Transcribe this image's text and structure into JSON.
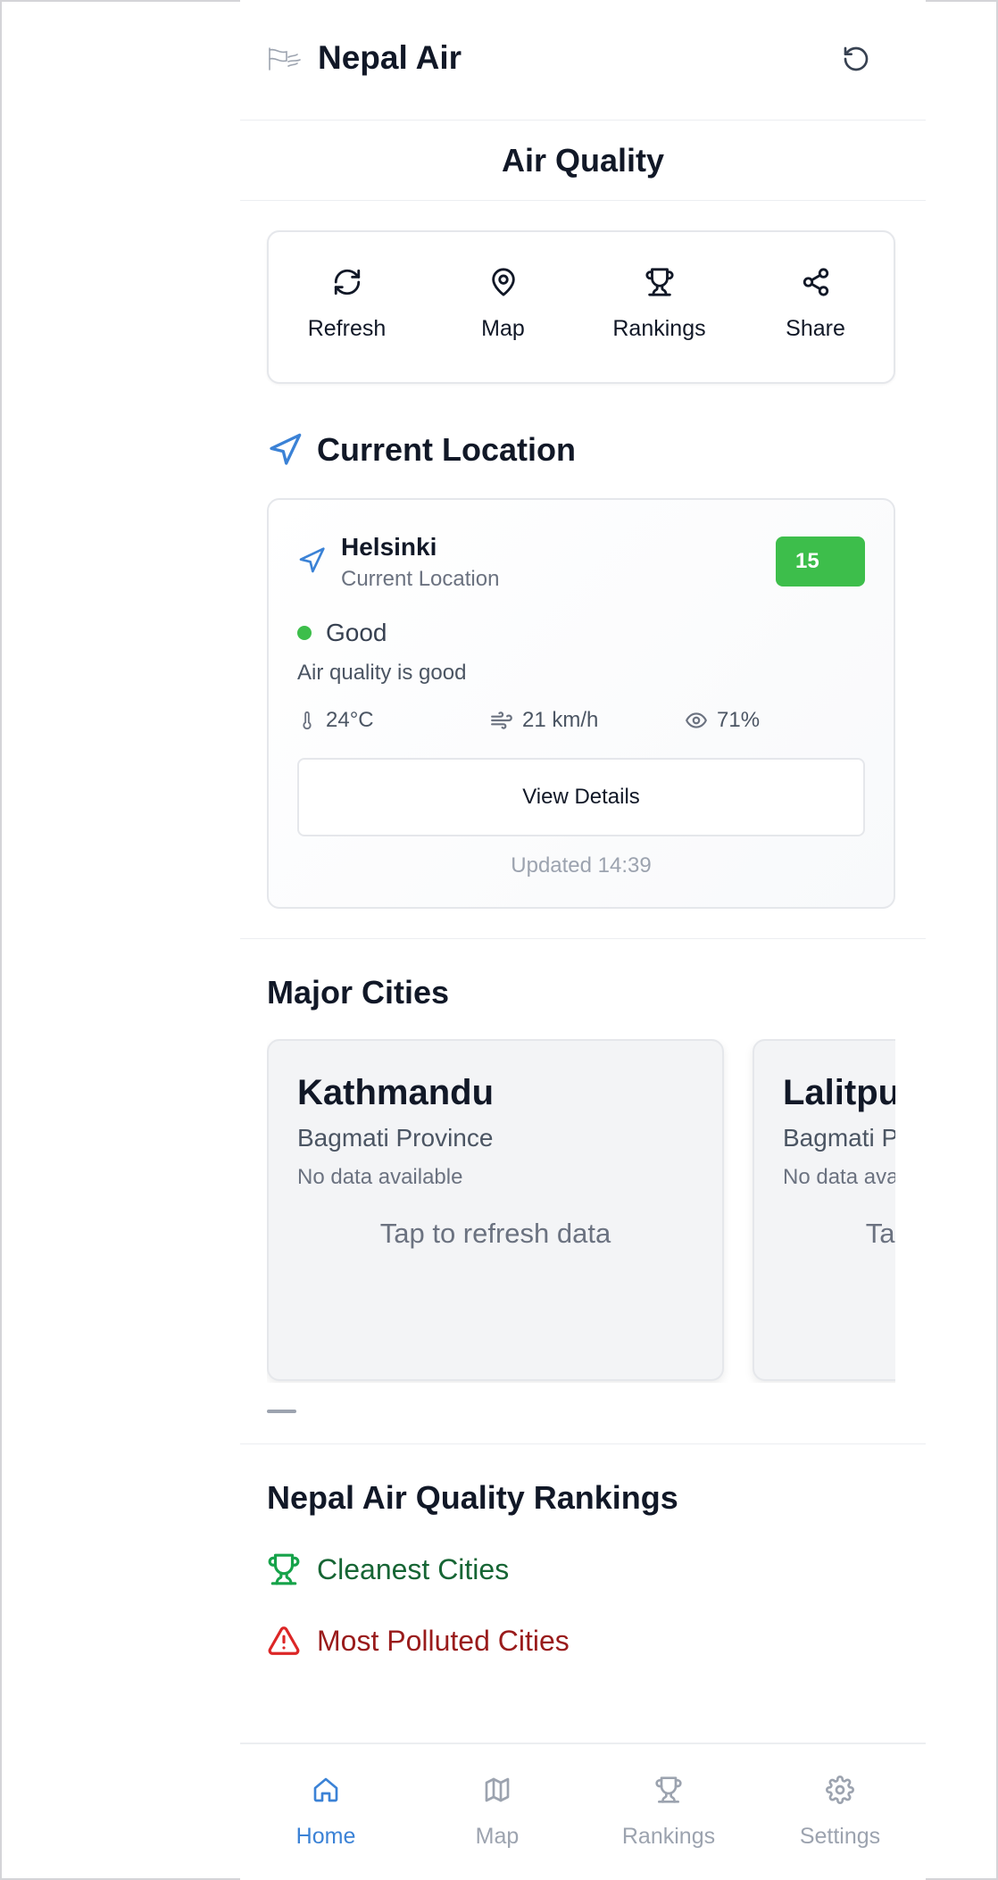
{
  "header": {
    "app_title": "Nepal Air",
    "page_title": "Air Quality"
  },
  "actions": [
    {
      "label": "Refresh",
      "icon": "refresh-icon"
    },
    {
      "label": "Map",
      "icon": "map-pin-icon"
    },
    {
      "label": "Rankings",
      "icon": "trophy-icon"
    },
    {
      "label": "Share",
      "icon": "share-icon"
    }
  ],
  "current_location": {
    "section_title": "Current Location",
    "city": "Helsinki",
    "subtitle": "Current Location",
    "aqi": "15",
    "status": "Good",
    "description": "Air quality is good",
    "temperature": "24°C",
    "wind": "21 km/h",
    "humidity": "71%",
    "details_button": "View Details",
    "updated": "Updated 14:39",
    "colors": {
      "good": "#3dbe4b",
      "accent": "#3b82d6"
    }
  },
  "major_cities": {
    "title": "Major Cities",
    "cities": [
      {
        "name": "Kathmandu",
        "province": "Bagmati Province",
        "status": "No data available",
        "action": "Tap to refresh data"
      },
      {
        "name": "Lalitpur",
        "province": "Bagmati Province",
        "status": "No data available",
        "action": "Tap to refresh data"
      }
    ]
  },
  "rankings": {
    "title": "Nepal Air Quality Rankings",
    "cleanest": "Cleanest Cities",
    "most_polluted": "Most Polluted Cities"
  },
  "bottom_nav": [
    {
      "label": "Home",
      "icon": "home-icon",
      "active": true
    },
    {
      "label": "Map",
      "icon": "map-icon",
      "active": false
    },
    {
      "label": "Rankings",
      "icon": "trophy-icon",
      "active": false
    },
    {
      "label": "Settings",
      "icon": "gear-icon",
      "active": false
    }
  ]
}
